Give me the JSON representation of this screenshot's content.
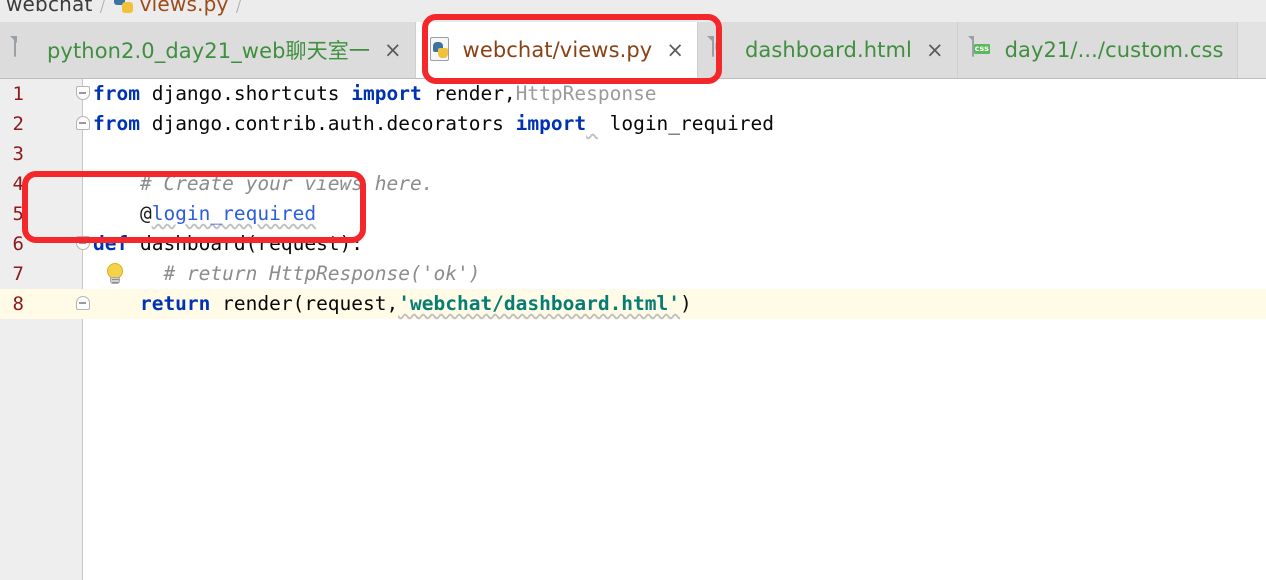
{
  "breadcrumb": {
    "items": [
      {
        "label": "webchat",
        "type": "folder"
      },
      {
        "label": "views.py",
        "type": "python-file"
      }
    ],
    "separator": "/"
  },
  "tabs": [
    {
      "label": "python2.0_day21_web聊天室一",
      "icon": "document-icon",
      "close": "×",
      "active": false
    },
    {
      "label": "webchat/views.py",
      "icon": "python-file-icon",
      "close": "×",
      "active": true
    },
    {
      "label": "dashboard.html",
      "icon": "html-file-icon",
      "close": "×",
      "active": false
    },
    {
      "label": "day21/.../custom.css",
      "icon": "css-file-icon",
      "close": "×",
      "active": false
    }
  ],
  "editor": {
    "filename": "webchat/views.py",
    "caret_line": 8,
    "lines": [
      {
        "number": "1",
        "fold": "open",
        "tokens": [
          {
            "t": "from",
            "c": "kw"
          },
          {
            "t": " django.shortcuts ",
            "c": "plain"
          },
          {
            "t": "import",
            "c": "kw"
          },
          {
            "t": " render,",
            "c": "plain"
          },
          {
            "t": "HttpResponse",
            "c": "dim"
          }
        ]
      },
      {
        "number": "2",
        "fold": "end",
        "tokens": [
          {
            "t": "from",
            "c": "kw"
          },
          {
            "t": " django.contrib.auth.decorators ",
            "c": "plain"
          },
          {
            "t": "import",
            "c": "kw"
          },
          {
            "t": " ",
            "c": "wavy-g"
          },
          {
            "t": " login_required",
            "c": "plain"
          }
        ]
      },
      {
        "number": "3",
        "fold": "",
        "tokens": []
      },
      {
        "number": "4",
        "fold": "",
        "tokens": [
          {
            "t": "    # Create your views here.",
            "c": "cmt"
          }
        ]
      },
      {
        "number": "5",
        "fold": "",
        "tokens": [
          {
            "t": "    @",
            "c": "at"
          },
          {
            "t": "login_required",
            "c": "deco wavy-g"
          }
        ]
      },
      {
        "number": "6",
        "fold": "open",
        "tokens": [
          {
            "t": "def",
            "c": "kw"
          },
          {
            "t": " dashboard(request):",
            "c": "plain"
          }
        ]
      },
      {
        "number": "7",
        "fold": "",
        "bulb": true,
        "tokens": [
          {
            "t": "      # return HttpResponse('ok')",
            "c": "cmt"
          }
        ]
      },
      {
        "number": "8",
        "fold": "end",
        "caret": true,
        "tokens": [
          {
            "t": "    return",
            "c": "kw"
          },
          {
            "t": " render(request,",
            "c": "plain"
          },
          {
            "t": "'webchat/dashboard.html'",
            "c": "str wavy-g"
          },
          {
            "t": ")",
            "c": "punc"
          }
        ]
      }
    ]
  },
  "annotations": [
    {
      "name": "tab-highlight",
      "target": "webchat/views.py",
      "shape": "rounded-rectangle",
      "color": "#f4282a"
    },
    {
      "name": "code-highlight",
      "target": "lines 4-5 (@login_required)",
      "shape": "rounded-rectangle",
      "color": "#f4282a"
    }
  ],
  "colors": {
    "annotation_red": "#f4282a",
    "tab_label_green": "#3f8f3f",
    "active_tab_label": "#8a4116",
    "keyword_blue": "#0033b3",
    "string_teal": "#067d74",
    "comment_grey": "#8c8c8c",
    "line_number_maroon": "#8b1a1a",
    "caret_line_bg": "#fffbe6",
    "gutter_bg": "#eeeeee"
  }
}
